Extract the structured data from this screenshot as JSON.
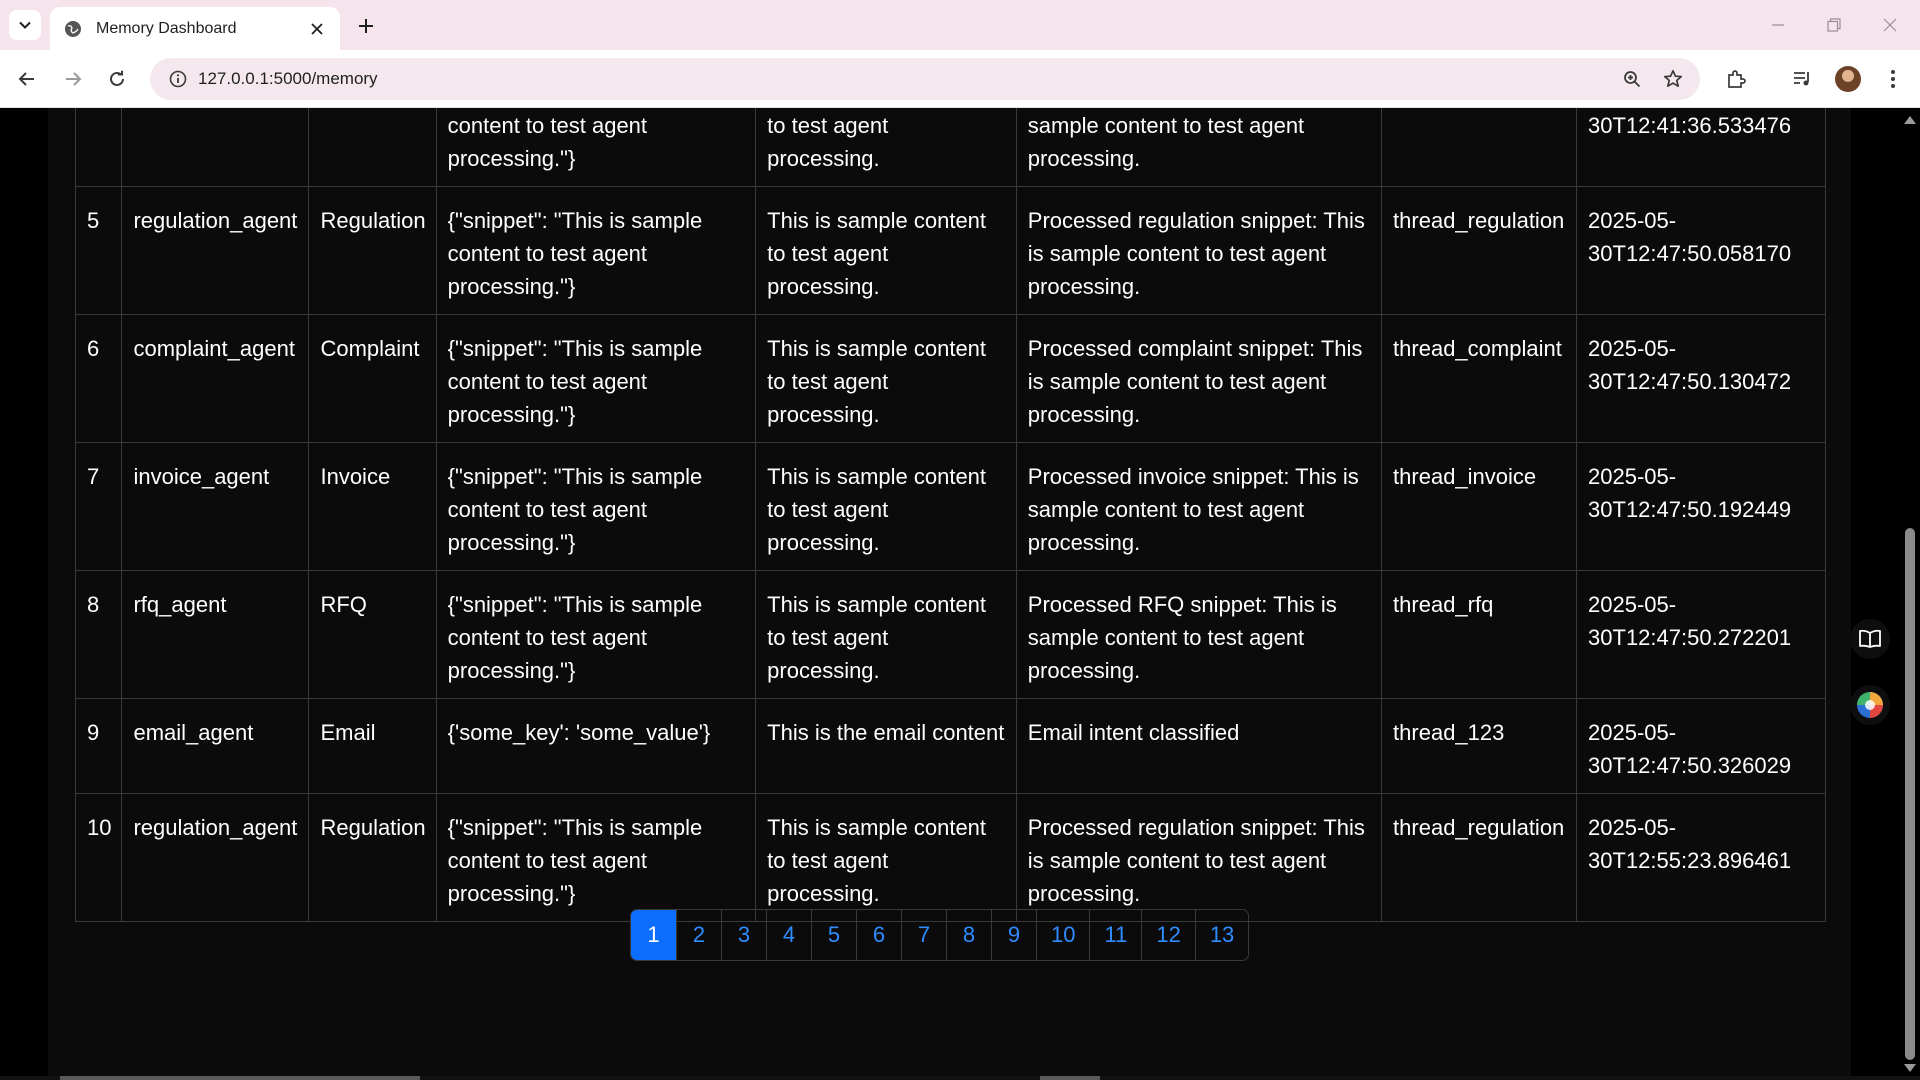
{
  "browser": {
    "tab_title": "Memory Dashboard",
    "url": "127.0.0.1:5000/memory"
  },
  "colors": {
    "accent": "#0d6efd",
    "link": "#2f8cff",
    "page_bg": "#000000",
    "table_text": "#ffffff"
  },
  "table": {
    "partial_row": {
      "input": "content to test agent processing.\"}",
      "content": "to test agent processing.",
      "output": "sample content to test agent processing.",
      "timestamp": "30T12:41:36.533476"
    },
    "rows": [
      {
        "id": "5",
        "agent": "regulation_agent",
        "type": "Regulation",
        "input": "{\"snippet\": \"This is sample content to test agent processing.\"}",
        "content": "This is sample content to test agent processing.",
        "output": "Processed regulation snippet: This is sample content to test agent processing.",
        "thread": "thread_regulation",
        "timestamp": "2025-05-30T12:47:50.058170"
      },
      {
        "id": "6",
        "agent": "complaint_agent",
        "type": "Complaint",
        "input": "{\"snippet\": \"This is sample content to test agent processing.\"}",
        "content": "This is sample content to test agent processing.",
        "output": "Processed complaint snippet: This is sample content to test agent processing.",
        "thread": "thread_complaint",
        "timestamp": "2025-05-30T12:47:50.130472"
      },
      {
        "id": "7",
        "agent": "invoice_agent",
        "type": "Invoice",
        "input": "{\"snippet\": \"This is sample content to test agent processing.\"}",
        "content": "This is sample content to test agent processing.",
        "output": "Processed invoice snippet: This is sample content to test agent processing.",
        "thread": "thread_invoice",
        "timestamp": "2025-05-30T12:47:50.192449"
      },
      {
        "id": "8",
        "agent": "rfq_agent",
        "type": "RFQ",
        "input": "{\"snippet\": \"This is sample content to test agent processing.\"}",
        "content": "This is sample content to test agent processing.",
        "output": "Processed RFQ snippet: This is sample content to test agent processing.",
        "thread": "thread_rfq",
        "timestamp": "2025-05-30T12:47:50.272201"
      },
      {
        "id": "9",
        "agent": "email_agent",
        "type": "Email",
        "input": "{'some_key': 'some_value'}",
        "content": "This is the email content",
        "output": "Email intent classified",
        "thread": "thread_123",
        "timestamp": "2025-05-30T12:47:50.326029"
      },
      {
        "id": "10",
        "agent": "regulation_agent",
        "type": "Regulation",
        "input": "{\"snippet\": \"This is sample content to test agent processing.\"}",
        "content": "This is sample content to test agent processing.",
        "output": "Processed regulation snippet: This is sample content to test agent processing.",
        "thread": "thread_regulation",
        "timestamp": "2025-05-30T12:55:23.896461"
      }
    ]
  },
  "pagination": {
    "pages": [
      "1",
      "2",
      "3",
      "4",
      "5",
      "6",
      "7",
      "8",
      "9",
      "10",
      "11",
      "12",
      "13"
    ],
    "current": "1"
  },
  "icons": {
    "tab_search": "chevron-down-icon",
    "favicon": "globe-icon",
    "tab_close": "close-icon",
    "new_tab": "plus-icon",
    "back": "arrow-left-icon",
    "forward": "arrow-right-icon",
    "reload": "reload-icon",
    "site_info": "info-icon",
    "zoom": "zoom-icon",
    "bookmark": "star-icon",
    "extensions": "puzzle-icon",
    "media": "media-control-icon",
    "menu": "more-vert-icon",
    "reading_mode": "book-icon",
    "side_panel_app": "colorful-orb-icon"
  }
}
